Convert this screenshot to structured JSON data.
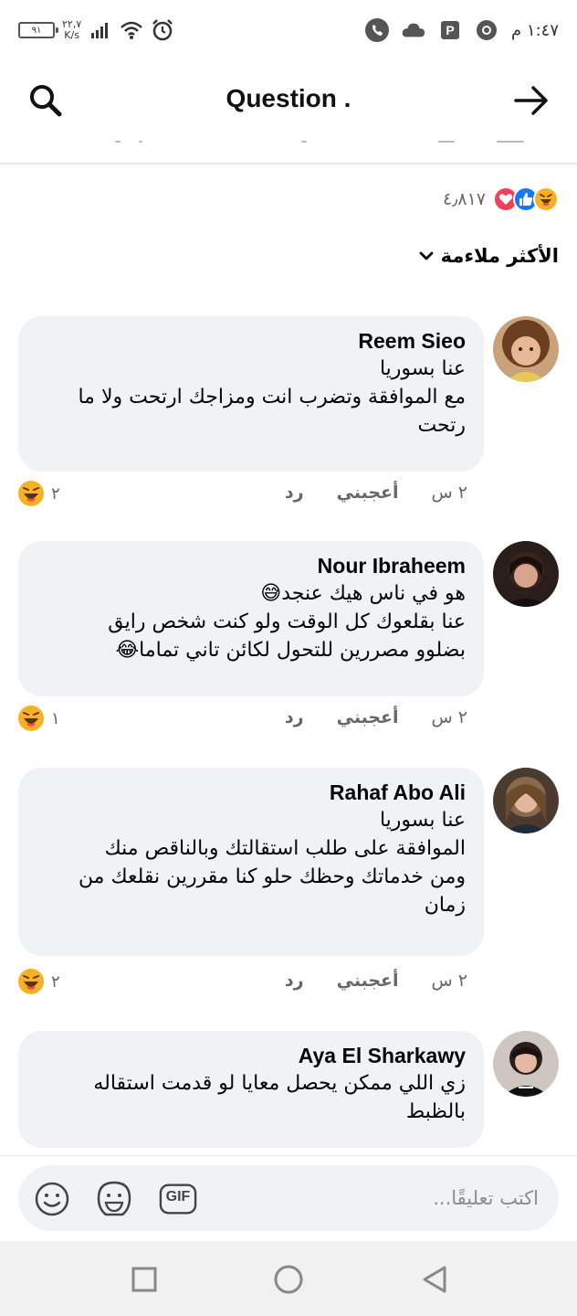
{
  "status_bar": {
    "time": "١:٤٧ م",
    "battery": "٩١",
    "speed_value": "٢٢,٧",
    "speed_unit": "K/s",
    "icons": [
      "battery-icon",
      "signal-icon",
      "wifi-icon",
      "alarm-icon",
      "call-icon",
      "cloud-icon",
      "parking-icon",
      "chrome-icon"
    ]
  },
  "header": {
    "title": "Question .",
    "search_icon": "search-icon",
    "forward_icon": "arrow-right-icon"
  },
  "reactions": {
    "count": "٤٫٨١٧",
    "types": [
      "haha",
      "like",
      "love"
    ]
  },
  "sort": {
    "label": "الأكثر ملاءمة"
  },
  "comments": [
    {
      "author": "Reem Sieo",
      "lines": [
        "عنا بسوريا",
        "مع الموافقة وتضرب انت ومزاجك ارتحت ولا ما",
        "رتحت"
      ],
      "time": "٢ س",
      "like": "أعجبني",
      "reply": "رد",
      "reaction_count": "٢"
    },
    {
      "author": "Nour Ibraheem",
      "lines": [
        "هو في ناس هيك عنجد😅",
        "عنا بقلعوك كل الوقت ولو كنت شخص رايق",
        "بضلوو مصررين للتحول لكائن تاني تماما😂"
      ],
      "time": "٢ س",
      "like": "أعجبني",
      "reply": "رد",
      "reaction_count": "١"
    },
    {
      "author": "Rahaf Abo Ali",
      "lines": [
        "عنا بسوريا",
        "الموافقة على طلب استقالتك وبالناقص منك",
        "ومن خدماتك وحظك حلو كنا مقررين نقلعك من",
        "زمان"
      ],
      "time": "٢ س",
      "like": "أعجبني",
      "reply": "رد",
      "reaction_count": "٢"
    },
    {
      "author": "Aya El Sharkawy",
      "lines": [
        "زي اللي ممكن يحصل معايا لو قدمت استقاله",
        "بالظبط"
      ]
    }
  ],
  "composer": {
    "placeholder": "اكتب تعليقًا...",
    "gif_label": "GIF"
  },
  "colors": {
    "bubble": "#f0f2f5",
    "meta_text": "#65676b",
    "like_blue": "#1877f2",
    "love_red": "#f33e58",
    "haha_yellow": "#f7b125"
  }
}
